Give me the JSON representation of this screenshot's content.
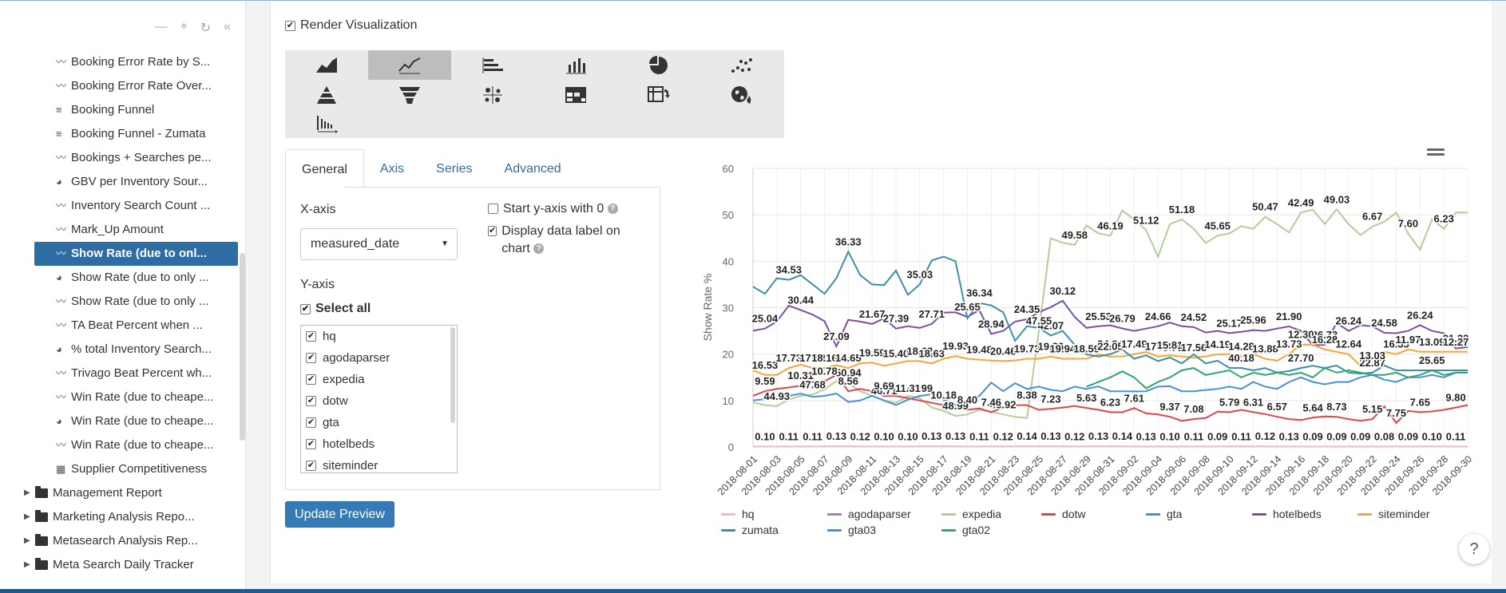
{
  "sidebar": {
    "tools": [
      "—",
      "⌖",
      "↻",
      "«"
    ],
    "partial_item": "...g...",
    "items": [
      {
        "label": "Booking Error Rate by S...",
        "icon": "line-chart-icon"
      },
      {
        "label": "Booking Error Rate Over...",
        "icon": "line-chart-icon"
      },
      {
        "label": "Booking Funnel",
        "icon": "bar-chart-icon"
      },
      {
        "label": "Booking Funnel - Zumata",
        "icon": "bar-chart-icon"
      },
      {
        "label": "Bookings + Searches pe...",
        "icon": "line-chart-icon"
      },
      {
        "label": "GBV per Inventory Sour...",
        "icon": "pie-chart-icon"
      },
      {
        "label": "Inventory Search Count ...",
        "icon": "line-chart-icon"
      },
      {
        "label": "Mark_Up Amount",
        "icon": "line-chart-icon"
      },
      {
        "label": "Show Rate (due to onl...",
        "icon": "line-chart-icon",
        "active": true
      },
      {
        "label": "Show Rate (due to only ...",
        "icon": "pie-chart-icon"
      },
      {
        "label": "Show Rate (due to only ...",
        "icon": "line-chart-icon"
      },
      {
        "label": "TA Beat Percent when ...",
        "icon": "line-chart-icon"
      },
      {
        "label": "% total Inventory Search...",
        "icon": "pie-chart-icon"
      },
      {
        "label": "Trivago Beat Percent wh...",
        "icon": "line-chart-icon"
      },
      {
        "label": "Win Rate (due to cheape...",
        "icon": "line-chart-icon"
      },
      {
        "label": "Win Rate (due to cheape...",
        "icon": "pie-chart-icon"
      },
      {
        "label": "Win Rate (due to cheape...",
        "icon": "line-chart-icon"
      },
      {
        "label": "Supplier Competitiveness",
        "icon": "dashboard-icon"
      }
    ],
    "folders": [
      "Management Report",
      "Marketing Analysis Repo...",
      "Metasearch Analysis Rep...",
      "Meta Search Daily Tracker"
    ]
  },
  "render_label": "Render Visualization",
  "viz_types": [
    "area",
    "line",
    "bar-horizontal",
    "bar-vertical",
    "pie",
    "scatter",
    "pyramid",
    "funnel",
    "scatter-plus",
    "heatmap-table",
    "pivot",
    "geo",
    "waterfall"
  ],
  "tabs": [
    "General",
    "Axis",
    "Series",
    "Advanced"
  ],
  "form": {
    "xaxis_label": "X-axis",
    "xaxis_value": "measured_date",
    "start_y0": "Start y-axis with 0",
    "display_label": "Display data label on chart",
    "yaxis_label": "Y-axis",
    "select_all": "Select all",
    "series_list": [
      "hq",
      "agodaparser",
      "expedia",
      "dotw",
      "gta",
      "hotelbeds",
      "siteminder"
    ],
    "update_button": "Update Preview"
  },
  "help_button": "?",
  "chart_data": {
    "type": "line",
    "ylabel": "Show Rate %",
    "xlabel": "",
    "ylim": [
      0,
      60
    ],
    "yticks": [
      0,
      10,
      20,
      30,
      40,
      50,
      60
    ],
    "x_tick_labels": [
      "2018-08-01",
      "2018-08-03",
      "2018-08-05",
      "2018-08-07",
      "2018-08-09",
      "2018-08-11",
      "2018-08-13",
      "2018-08-15",
      "2018-08-17",
      "2018-08-19",
      "2018-08-21",
      "2018-08-23",
      "2018-08-25",
      "2018-08-27",
      "2018-08-29",
      "2018-08-31",
      "2018-09-02",
      "2018-09-04",
      "2018-09-06",
      "2018-09-08",
      "2018-09-10",
      "2018-09-12",
      "2018-09-14",
      "2018-09-16",
      "2018-09-18",
      "2018-09-20",
      "2018-09-22",
      "2018-09-24",
      "2018-09-26",
      "2018-09-28",
      "2018-09-30"
    ],
    "n_points": 61,
    "series": [
      {
        "name": "hq",
        "color": "#f4b8c6",
        "values": [
          0.1,
          0.1,
          0.11,
          0.11,
          0.11,
          0.11,
          0.13,
          0.13,
          0.12,
          0.12,
          0.1,
          0.1,
          0.1,
          0.1,
          0.13,
          0.13,
          0.13,
          0.13,
          0.11,
          0.11,
          0.12,
          0.12,
          0.14,
          0.14,
          0.13,
          0.13,
          0.12,
          0.12,
          0.14,
          0.14,
          0.13,
          0.13,
          0.1,
          0.1,
          0.11,
          0.11,
          0.09,
          0.09,
          0.11,
          0.11,
          0.12,
          0.12,
          0.13,
          0.13,
          0.09,
          0.09,
          0.09,
          0.09,
          0.09,
          0.09,
          0.08,
          0.08,
          0.09,
          0.09,
          0.1,
          0.1,
          0.11,
          0.11,
          0.11,
          0.11,
          0.11
        ]
      },
      {
        "name": "agodaparser",
        "color": "#b07db0",
        "values": [
          null,
          null,
          null,
          null,
          null,
          null,
          null,
          null,
          null,
          null,
          null,
          null,
          null,
          null,
          null,
          null,
          null,
          null,
          null,
          null,
          null,
          null,
          null,
          null,
          null,
          null,
          null,
          null,
          null,
          null,
          null,
          null,
          null,
          null,
          null,
          null,
          null,
          null,
          null,
          null,
          null,
          null,
          null,
          null,
          null,
          null,
          null,
          null,
          null,
          null,
          null,
          null,
          null,
          null,
          null,
          null,
          null,
          null,
          null,
          null,
          null
        ]
      },
      {
        "name": "expedia",
        "color": "#b5cc9a",
        "values": [
          9.6,
          9.0,
          8.8,
          10.2,
          11.0,
          11.3,
          12.4,
          14.2,
          13.8,
          12.0,
          11.0,
          10.0,
          9.5,
          11.0,
          10.5,
          8.5,
          7.8,
          6.67,
          7.0,
          8.0,
          7.6,
          7.0,
          6.5,
          6.23,
          25.0,
          44.93,
          44.0,
          43.5,
          47.68,
          46.0,
          45.5,
          50.94,
          49.0,
          46.71,
          40.99,
          48.0,
          48.99,
          47.0,
          43.92,
          45.5,
          46.0,
          47.55,
          47.0,
          49.58,
          48.0,
          46.19,
          50.5,
          51.12,
          48.0,
          51.18,
          48.0,
          45.65,
          47.5,
          48.5,
          50.47,
          46.0,
          42.49,
          49.03,
          47.0,
          50.5,
          50.5
        ]
      },
      {
        "name": "dotw",
        "color": "#e0454f",
        "values": [
          11.0,
          12.0,
          12.5,
          12.8,
          13.2,
          14.0,
          14.19,
          15.5,
          12.0,
          12.5,
          12.0,
          11.0,
          11.0,
          10.5,
          10.0,
          9.5,
          9.0,
          8.5,
          8.0,
          8.3,
          7.5,
          8.5,
          9.0,
          9.0,
          8.0,
          8.2,
          8.5,
          8.8,
          8.4,
          8.0,
          7.5,
          7.46,
          8.38,
          7.23,
          7.0,
          6.5,
          5.63,
          6.0,
          6.23,
          7.61,
          7.5,
          8.0,
          7.5,
          7.08,
          6.5,
          6.0,
          5.79,
          6.31,
          6.57,
          6.5,
          6.0,
          5.64,
          6.0,
          8.73,
          5.15,
          7.75,
          7.5,
          7.65,
          8.0,
          8.5,
          9.0
        ]
      },
      {
        "name": "gta",
        "color": "#4a90d9",
        "values": [
          null,
          null,
          null,
          null,
          null,
          null,
          null,
          null,
          null,
          null,
          null,
          null,
          null,
          null,
          null,
          null,
          null,
          null,
          null,
          null,
          null,
          null,
          null,
          null,
          null,
          null,
          null,
          null,
          null,
          null,
          null,
          null,
          null,
          null,
          null,
          null,
          null,
          null,
          null,
          null,
          null,
          null,
          null,
          null,
          null,
          null,
          null,
          null,
          null,
          null,
          null,
          null,
          null,
          null,
          null,
          null,
          null,
          null,
          null,
          null,
          null
        ]
      },
      {
        "name": "hotelbeds",
        "color": "#7b4fa3",
        "values": [
          25.04,
          25.5,
          27.0,
          30.44,
          29.5,
          28.5,
          27.09,
          21.67,
          27.39,
          27.0,
          26.5,
          27.71,
          25.5,
          26.0,
          25.65,
          26.5,
          28.94,
          29.0,
          28.0,
          29.5,
          24.35,
          25.0,
          27.0,
          27.5,
          29.0,
          30.12,
          31.5,
          28.0,
          25.65,
          26.0,
          26.2,
          25.53,
          25.0,
          25.5,
          26.0,
          26.79,
          26.0,
          25.8,
          24.66,
          25.0,
          24.52,
          24.8,
          25.17,
          25.0,
          25.5,
          25.96,
          25.0,
          21.9,
          22.0,
          26.73,
          25.0,
          26.24,
          26.0,
          24.58,
          24.5,
          25.0,
          26.24,
          25.0,
          24.5,
          21.22,
          21.5
        ]
      },
      {
        "name": "siteminder",
        "color": "#f6a636",
        "values": [
          16.53,
          15.5,
          15.5,
          17.0,
          17.73,
          17.0,
          17.0,
          17.58,
          17.0,
          18.0,
          18.16,
          17.5,
          18.0,
          18.5,
          18.5,
          18.0,
          19.0,
          19.59,
          19.0,
          18.8,
          18.62,
          18.5,
          18.63,
          19.0,
          19.0,
          19.5,
          19.0,
          19.0,
          19.0,
          19.93,
          19.48,
          19.5,
          20.0,
          20.46,
          19.5,
          19.73,
          19.5,
          19.26,
          19.5,
          19.94,
          20.0,
          19.5,
          20.0,
          19.0,
          18.59,
          20.0,
          22.05,
          22.0,
          21.0,
          20.5,
          20.0,
          17.49,
          17.53,
          20.5,
          20.0,
          21.0,
          20.5,
          20.5,
          20.5,
          20.5,
          20.5
        ]
      },
      {
        "name": "zumata",
        "color": "#3d8fa8",
        "values": [
          34.53,
          33.0,
          36.33,
          36.0,
          37.0,
          35.03,
          33.0,
          36.34,
          42.07,
          37.0,
          35.0,
          34.84,
          38.0,
          32.79,
          35.0,
          40.18,
          41.0,
          40.0,
          27.7,
          31.0,
          30.5,
          29.0,
          22.87,
          26.0,
          25.65,
          24.0,
          25.0,
          22.0,
          19.93,
          19.48,
          20.0,
          21.0,
          19.0,
          19.73,
          18.5,
          19.26,
          18.0,
          19.94,
          18.0,
          18.59,
          17.0,
          17.0,
          16.5,
          17.0,
          16.0,
          16.35,
          17.0,
          17.49,
          17.0,
          17.53,
          16.0,
          15.81,
          16.0,
          17.56,
          16.5,
          16.5,
          16.5,
          16.5,
          16.5,
          16.5,
          16.5
        ]
      },
      {
        "name": "gta03",
        "color": "#4a90d9",
        "values": [
          10.0,
          10.31,
          10.5,
          11.0,
          11.5,
          10.78,
          11.0,
          11.5,
          9.69,
          10.0,
          11.0,
          10.0,
          9.0,
          10.18,
          11.0,
          11.31,
          10.18,
          9.0,
          10.0,
          11.0,
          13.88,
          12.0,
          13.73,
          12.5,
          13.0,
          12.3,
          12.0,
          13.0,
          12.5,
          13.03,
          12.0,
          12.0,
          11.97,
          12.0,
          13.0,
          13.09,
          12.0,
          12.0,
          12.27,
          12.5,
          13.0,
          12.5,
          14.0,
          13.0,
          12.5,
          14.0,
          15.0,
          14.0,
          13.5,
          14.0,
          14.0,
          15.0,
          15.5,
          14.5,
          14.0,
          15.0,
          15.0,
          15.5,
          15.0,
          16.0,
          16.0
        ]
      },
      {
        "name": "gta02",
        "color": "#2ea86a",
        "values": [
          null,
          null,
          null,
          null,
          null,
          null,
          null,
          null,
          null,
          null,
          null,
          null,
          null,
          null,
          null,
          null,
          null,
          null,
          null,
          null,
          null,
          null,
          null,
          null,
          null,
          null,
          null,
          null,
          13.0,
          14.0,
          15.0,
          16.28,
          15.0,
          12.64,
          14.0,
          15.0,
          16.5,
          17.0,
          15.5,
          16.0,
          16.5,
          15.0,
          16.0,
          15.5,
          16.0,
          15.5,
          16.0,
          15.0,
          17.0,
          16.0,
          16.5,
          16.0,
          15.5,
          15.5,
          16.0,
          15.0,
          15.5,
          16.5,
          15.5,
          16.0,
          16.0
        ]
      }
    ],
    "data_labels": [
      {
        "series": "zumata",
        "values": [
          "34.53",
          "36.33",
          "35.03",
          "36.34",
          "42.07",
          "34.84",
          "32.79",
          "40.18",
          "27.70",
          "22.87",
          "25.65"
        ]
      },
      {
        "series": "hotelbeds",
        "values": [
          "25.04",
          "30.44",
          "27.09",
          "21.67",
          "27.39",
          "27.71",
          "25.65",
          "28.94",
          "24.35",
          "30.12",
          "25.53",
          "26.79",
          "24.66",
          "24.52",
          "25.17",
          "25.96",
          "21.90",
          "26.73",
          "26.24",
          "24.58",
          "26.24",
          "21.22"
        ]
      },
      {
        "series": "expedia",
        "values": [
          "44.93",
          "47.68",
          "50.94",
          "46.71",
          "40.99",
          "48.99",
          "43.92",
          "47.55",
          "49.58",
          "46.19",
          "51.12",
          "51.18",
          "45.65",
          "50.47",
          "42.49",
          "49.03",
          "6.67",
          "7.60",
          "6.23"
        ]
      },
      {
        "series": "siteminder",
        "values": [
          "16.53",
          "17.73",
          "17.58",
          "18.16",
          "14.65",
          "19.59",
          "15.40",
          "18.62",
          "18.63",
          "19.93",
          "19.48",
          "20.46",
          "19.73",
          "19.26",
          "19.94",
          "18.59",
          "22.05",
          "17.49",
          "17.53",
          "15.81",
          "17.56",
          "14.19",
          "14.28",
          "13.88",
          "13.73",
          "12.30",
          "16.28",
          "12.64",
          "13.03",
          "16.35",
          "11.97",
          "13.09",
          "12.27"
        ]
      },
      {
        "series": "dotw",
        "values": [
          "9.59",
          "10.31",
          "10.78",
          "8.56",
          "9.69",
          "11.31",
          "10.18",
          "8.40",
          "7.46",
          "8.38",
          "7.23",
          "5.63",
          "6.23",
          "7.61",
          "9.37",
          "7.08",
          "5.79",
          "6.31",
          "6.57",
          "5.64",
          "8.73",
          "5.15",
          "7.75",
          "7.65",
          "9.80"
        ]
      },
      {
        "series": "hq",
        "values": [
          "0.10",
          "0.11",
          "0.11",
          "0.13",
          "0.12",
          "0.10",
          "0.10",
          "0.13",
          "0.13",
          "0.11",
          "0.12",
          "0.14",
          "0.13",
          "0.12",
          "0.13",
          "0.14",
          "0.13",
          "0.10",
          "0.11",
          "0.09",
          "0.11",
          "0.12",
          "0.13",
          "0.09",
          "0.09",
          "0.09",
          "0.08",
          "0.09",
          "0.10",
          "0.11"
        ]
      }
    ]
  },
  "legend": [
    "hq",
    "agodaparser",
    "expedia",
    "dotw",
    "gta",
    "hotelbeds",
    "siteminder",
    "zumata",
    "gta03",
    "gta02"
  ]
}
